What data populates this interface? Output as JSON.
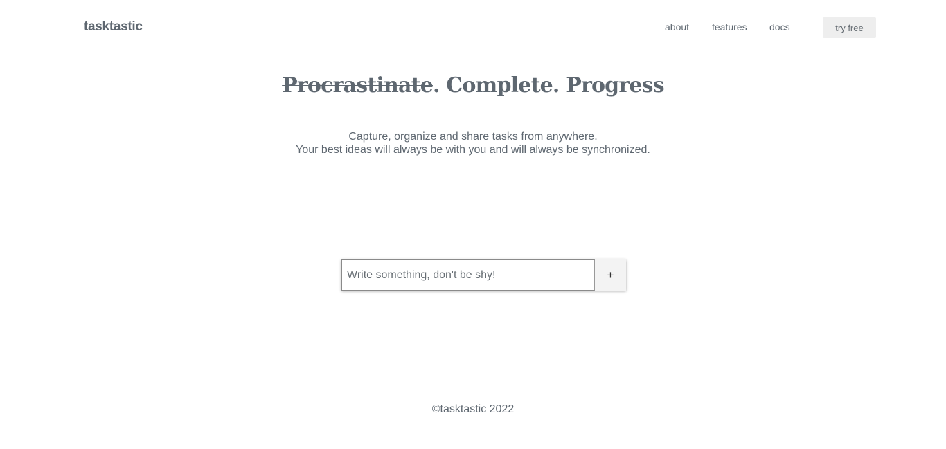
{
  "header": {
    "logo": "tasktastic",
    "nav": {
      "about": "about",
      "features": "features",
      "docs": "docs"
    },
    "cta_label": "try free"
  },
  "hero": {
    "title_struck": "Procrastinate",
    "title_rest": ". Complete. Progress",
    "subtitle_line1": "Capture, organize and share tasks from anywhere.",
    "subtitle_line2": "Your best ideas will always be with you and will always be synchronized."
  },
  "task_form": {
    "input_value": "",
    "input_placeholder": "Write something, don't be shy!",
    "add_label": "+"
  },
  "footer": {
    "copyright": "©tasktastic 2022"
  },
  "colors": {
    "text": "#5e6770",
    "button_bg": "#eeeeee",
    "background": "#ffffff"
  }
}
